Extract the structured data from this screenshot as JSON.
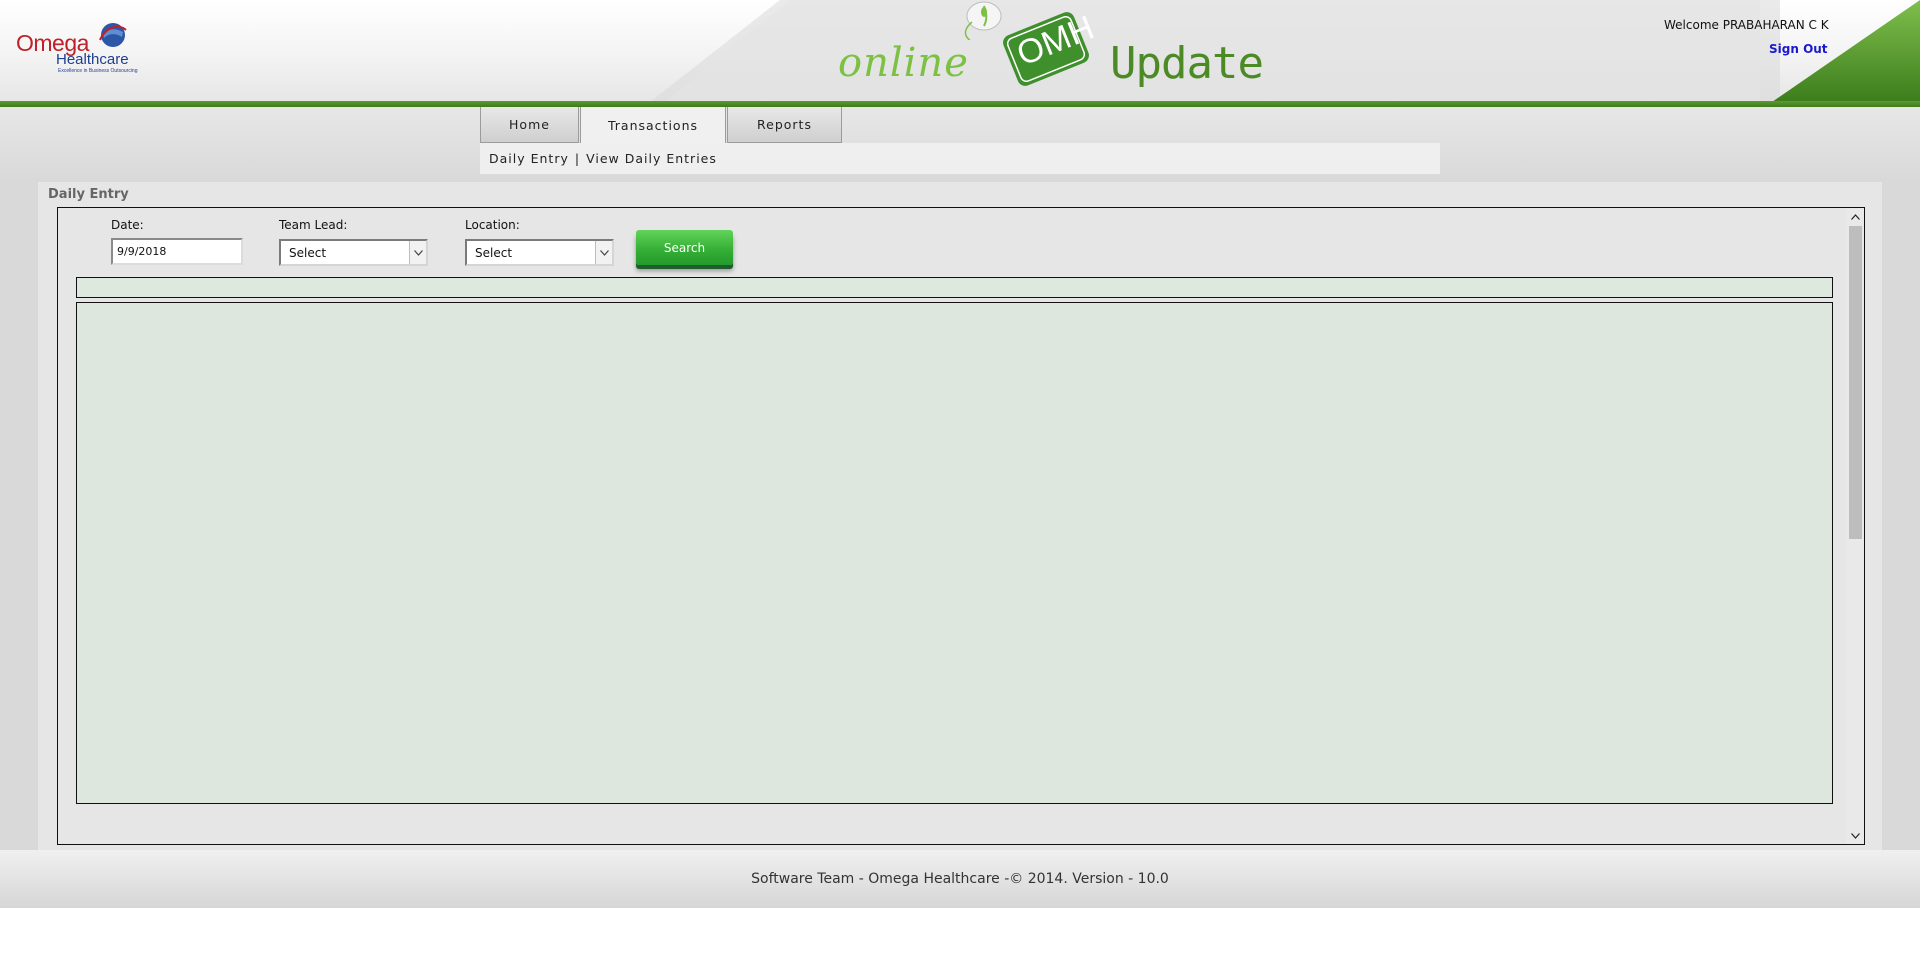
{
  "header": {
    "logo": {
      "line1": "Omega",
      "line2": "Healthcare",
      "tagline": "Excellence in Business Outsourcing"
    },
    "brand": {
      "online": "online",
      "badge": "OMH",
      "update": "Update"
    },
    "welcome": "Welcome PRABAHARAN C K",
    "signout_label": "Sign Out"
  },
  "nav": {
    "tabs": [
      {
        "label": "Home"
      },
      {
        "label": "Transactions"
      },
      {
        "label": "Reports"
      }
    ],
    "active_tab": "Transactions",
    "subnav": {
      "item1": "Daily Entry",
      "separator": "|",
      "item2": "View Daily Entries"
    }
  },
  "panel": {
    "title": "Daily Entry",
    "filters": {
      "date_label": "Date:",
      "date_value": "9/9/2018",
      "team_lead_label": "Team Lead:",
      "team_lead_value": "Select",
      "location_label": "Location:",
      "location_value": "Select"
    },
    "search_label": "Search"
  },
  "footer": {
    "text": "Software Team - Omega Healthcare -© 2014. Version - 10.0"
  },
  "colors": {
    "accent_green": "#4c8a25",
    "header_line": "#5e9a32",
    "link_blue": "#1a1acc",
    "grid_bg": "#dde7de",
    "logo_red": "#c0202a",
    "logo_blue": "#1f3f8f"
  }
}
